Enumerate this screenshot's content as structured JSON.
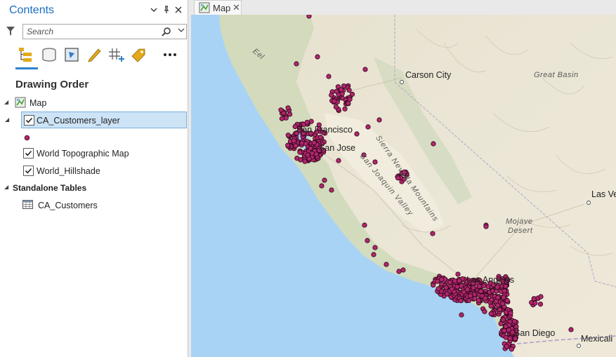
{
  "contents": {
    "title": "Contents",
    "header_icons": [
      "dropdown-icon",
      "pin-icon",
      "close-icon"
    ],
    "search": {
      "placeholder": "Search"
    },
    "toolbar_icons": [
      "list-by-drawing-order-icon",
      "list-by-data-source-icon",
      "list-by-selection-icon",
      "list-by-editing-icon",
      "list-by-snapping-icon",
      "list-by-labeling-icon",
      "more-icon"
    ],
    "drawing_order_title": "Drawing Order",
    "tree": {
      "map_label": "Map",
      "layer_label": "CA_Customers_layer",
      "topo_label": "World Topographic Map",
      "hillshade_label": "World_Hillshade",
      "standalone_label": "Standalone Tables",
      "table_label": "CA_Customers"
    },
    "accent_color": "#1b6ec2",
    "selected_row_color": "#cde3f6",
    "point_color": "#b1266d"
  },
  "map_view": {
    "tab_label": "Map",
    "tab_close": "✕",
    "labels": {
      "carson_city": "Carson City",
      "great_basin": "Great Basin",
      "san_francisco": "San Francisco",
      "san_jose": "San Jose",
      "sierra_nevada": "Sierra Nevada Mountains",
      "san_joaquin": "San Joaquin Valley",
      "las_vegas": "Las Ve",
      "mojave": "Mojave",
      "desert": "Desert",
      "los_angeles": "Los Angeles",
      "san_diego": "San Diego",
      "mexicali": "Mexicali",
      "eel": "Eel"
    }
  }
}
